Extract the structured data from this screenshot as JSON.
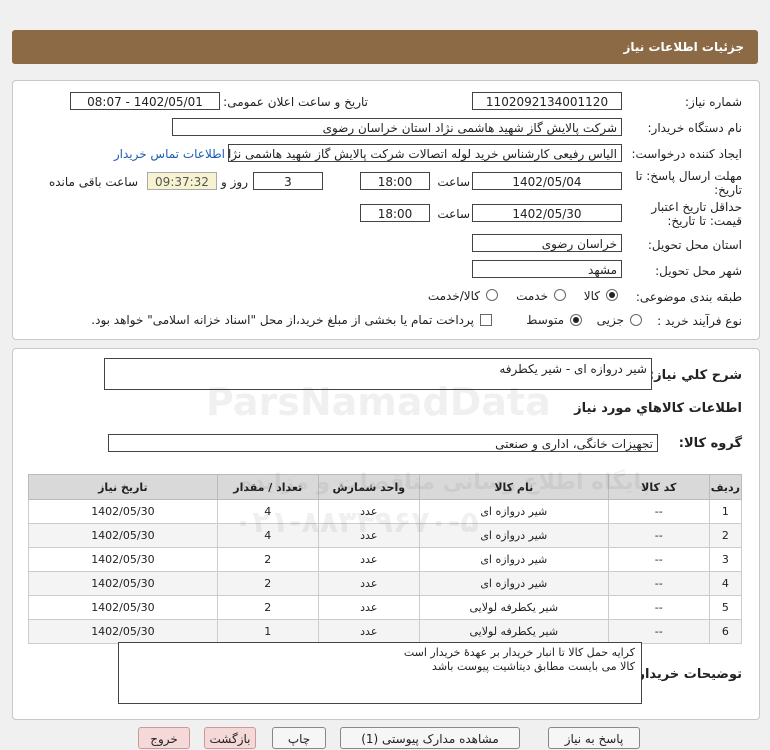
{
  "page_title": "جزئیات اطلاعات نیاز",
  "fields": {
    "need_number_label": "شماره نیاز:",
    "need_number": "1102092134001120",
    "announce_label": "تاریخ و ساعت اعلان عمومی:",
    "announce_value": "1402/05/01 - 08:07",
    "buyer_label": "نام دستگاه خریدار:",
    "buyer_value": "شرکت پالایش گاز شهید هاشمی نژاد   استان خراسان رضوی",
    "creator_label": "ایجاد کننده درخواست:",
    "creator_value": "الیاس رفیعی کارشناس خرید لوله اتصالات شرکت پالایش گاز شهید هاشمی نژاد",
    "contact_link": "اطلاعات تماس خریدار",
    "deadline_label_1": "مهلت ارسال پاسخ: تا",
    "deadline_label_2": "تاریخ:",
    "deadline_date": "1402/05/04",
    "time_label": "ساعت",
    "deadline_time": "18:00",
    "days_value": "3",
    "days_label": "روز و",
    "remaining_time": "09:37:32",
    "remaining_label": "ساعت باقی مانده",
    "validity_label_1": "حداقل تاریخ اعتبار",
    "validity_label_2": "قیمت: تا تاریخ:",
    "validity_date": "1402/05/30",
    "validity_time": "18:00",
    "province_label": "استان محل تحویل:",
    "province_value": "خراسان رضوی",
    "city_label": "شهر محل تحویل:",
    "city_value": "مشهد",
    "category_label": "طبقه بندی موضوعی:",
    "category_options": [
      "کالا",
      "خدمت",
      "کالا/خدمت"
    ],
    "process_label": "نوع فرآیند خرید :",
    "process_options": [
      "جزیی",
      "متوسط"
    ],
    "payment_note": "پرداخت تمام یا بخشی از مبلغ خرید،از محل \"اسناد خزانه اسلامی\" خواهد بود."
  },
  "summary": {
    "general_label": "شرح کلي نياز:",
    "general_value": "شیر دروازه ای - شیر یکطرفه",
    "items_header": "اطلاعات کالاهاي مورد نياز",
    "group_label": "گروه کالا:",
    "group_value": "تجهیزات خانگی، اداری و صنعتی"
  },
  "table": {
    "headers": [
      "ردیف",
      "کد کالا",
      "نام کالا",
      "واحد شمارش",
      "تعداد / مقدار",
      "تاریخ نیاز"
    ],
    "rows": [
      [
        "1",
        "--",
        "شیر دروازه ای",
        "عدد",
        "4",
        "1402/05/30"
      ],
      [
        "2",
        "--",
        "شیر دروازه ای",
        "عدد",
        "4",
        "1402/05/30"
      ],
      [
        "3",
        "--",
        "شیر دروازه ای",
        "عدد",
        "2",
        "1402/05/30"
      ],
      [
        "4",
        "--",
        "شیر دروازه ای",
        "عدد",
        "2",
        "1402/05/30"
      ],
      [
        "5",
        "--",
        "شیر یکطرفه لولایی",
        "عدد",
        "2",
        "1402/05/30"
      ],
      [
        "6",
        "--",
        "شیر یکطرفه لولایی",
        "عدد",
        "1",
        "1402/05/30"
      ]
    ]
  },
  "buyer_notes": {
    "label": "توضیحات خریدار:",
    "line1": "کرایه حمل کالا تا انبار خریدار بر عهدۀ خریدار است",
    "line2": "کالا می بایست مطابق دیتاشیت پیوست باشد"
  },
  "buttons": {
    "reply": "پاسخ به نیاز",
    "docs": "مشاهده مدارک پیوستی (1)",
    "print": "چاپ",
    "back": "بازگشت",
    "exit": "خروج"
  },
  "watermark": {
    "brand": "ParsNamadData",
    "phone": "۰۲۱-۸۸۳۴۹۶۷۰-۵",
    "site": "پایگاه اطلاع رسانی مناقصات و مزایده"
  },
  "colors": {
    "title_bar": "#8b6a45",
    "link": "#1a5fb4"
  }
}
